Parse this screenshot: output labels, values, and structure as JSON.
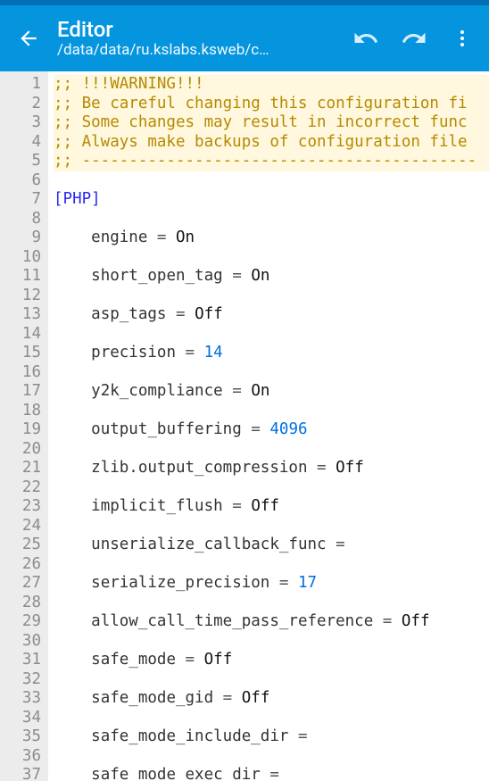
{
  "toolbar": {
    "title": "Editor",
    "subtitle": "/data/data/ru.kslabs.ksweb/c…"
  },
  "gutter": {
    "start": 1,
    "end": 37
  },
  "code": {
    "lines": [
      {
        "type": "comment",
        "prefix": ";; ",
        "text": "!!!WARNING!!!"
      },
      {
        "type": "comment",
        "prefix": ";; ",
        "text": "Be careful changing this configuration fi"
      },
      {
        "type": "comment",
        "prefix": ";; ",
        "text": "Some changes may result in incorrect func"
      },
      {
        "type": "comment",
        "prefix": ";; ",
        "text": "Always make backups of configuration file"
      },
      {
        "type": "comment",
        "prefix": ";; ",
        "text": "------------------------------------------"
      },
      {
        "type": "blank"
      },
      {
        "type": "section",
        "text": "[PHP]"
      },
      {
        "type": "blank"
      },
      {
        "type": "kv",
        "key": "engine",
        "value": "On",
        "valType": "onoff"
      },
      {
        "type": "blank"
      },
      {
        "type": "kv",
        "key": "short_open_tag",
        "value": "On",
        "valType": "onoff"
      },
      {
        "type": "blank"
      },
      {
        "type": "kv",
        "key": "asp_tags",
        "value": "Off",
        "valType": "onoff"
      },
      {
        "type": "blank"
      },
      {
        "type": "kv",
        "key": "precision",
        "value": "14",
        "valType": "num"
      },
      {
        "type": "blank"
      },
      {
        "type": "kv",
        "key": "y2k_compliance",
        "value": "On",
        "valType": "onoff"
      },
      {
        "type": "blank"
      },
      {
        "type": "kv",
        "key": "output_buffering",
        "value": "4096",
        "valType": "num"
      },
      {
        "type": "blank"
      },
      {
        "type": "kv",
        "key": "zlib.output_compression",
        "value": "Off",
        "valType": "onoff"
      },
      {
        "type": "blank"
      },
      {
        "type": "kv",
        "key": "implicit_flush",
        "value": "Off",
        "valType": "onoff"
      },
      {
        "type": "blank"
      },
      {
        "type": "kv",
        "key": "unserialize_callback_func",
        "value": "",
        "valType": "empty"
      },
      {
        "type": "blank"
      },
      {
        "type": "kv",
        "key": "serialize_precision",
        "value": "17",
        "valType": "num"
      },
      {
        "type": "blank"
      },
      {
        "type": "kv",
        "key": "allow_call_time_pass_reference",
        "value": "Off",
        "valType": "onoff"
      },
      {
        "type": "blank"
      },
      {
        "type": "kv",
        "key": "safe_mode",
        "value": "Off",
        "valType": "onoff"
      },
      {
        "type": "blank"
      },
      {
        "type": "kv",
        "key": "safe_mode_gid",
        "value": "Off",
        "valType": "onoff"
      },
      {
        "type": "blank"
      },
      {
        "type": "kv",
        "key": "safe_mode_include_dir",
        "value": "",
        "valType": "empty"
      },
      {
        "type": "blank"
      },
      {
        "type": "kv_partial",
        "key": "safe_mode_exec_dir",
        "value": "",
        "valType": "empty"
      }
    ],
    "indent": "    ",
    "warningBgLines": 5
  }
}
